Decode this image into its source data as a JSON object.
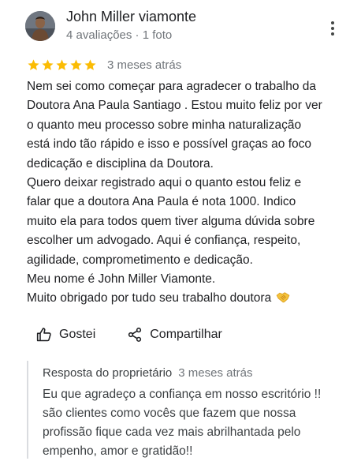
{
  "author": {
    "name": "John Miller viamonte",
    "meta": "4 avaliações · 1 foto"
  },
  "review": {
    "rating": 5,
    "max_rating": 5,
    "date": "3 meses atrás",
    "lines": [
      "Nem sei como começar para agradecer o trabalho da",
      "Doutora Ana Paula Santiago . Estou muito feliz por ver",
      "o quanto meu processo sobre minha naturalização",
      "está indo tão rápido e isso e possível graças ao foco",
      "dedicação e disciplina da Doutora.",
      "Quero deixar registrado aqui o quanto estou feliz e",
      "falar que a doutora Ana Paula é nota 1000. Indico",
      "muito ela para todos quem tiver alguma dúvida sobre",
      "escolher um advogado. Aqui é confiança, respeito,",
      "agilidade, comprometimento e dedicação.",
      "Meu nome é John Miller Viamonte.",
      "Muito obrigado por tudo seu trabalho doutora"
    ],
    "emoji": "handshake-emoji"
  },
  "actions": {
    "like_label": "Gostei",
    "share_label": "Compartilhar"
  },
  "owner_reply": {
    "label": "Resposta do proprietário",
    "date": "3 meses atrás",
    "lines": [
      "Eu que agradeço a confiança em nosso escritório !!",
      "são clientes como vocês que fazem que nossa",
      "profissão fique cada vez mais abrilhantada pelo",
      "empenho, amor e gratidão!!"
    ]
  },
  "colors": {
    "star": "#fbbc04",
    "text": "#202124",
    "secondary_text": "#70757a",
    "divider": "#dadce0"
  },
  "icons": [
    "more-vert-icon",
    "star-icon",
    "thumbs-up-icon",
    "share-icon",
    "handshake-emoji"
  ]
}
